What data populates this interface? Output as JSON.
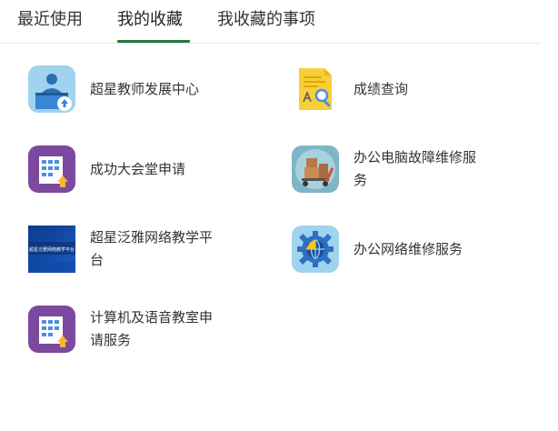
{
  "tabs": [
    {
      "label": "最近使用"
    },
    {
      "label": "我的收藏"
    },
    {
      "label": "我收藏的事项"
    }
  ],
  "active_tab": "我的收藏",
  "apps": [
    {
      "label": "超星教师发展中心",
      "icon": "teacher-podium-icon"
    },
    {
      "label": "成绩查询",
      "icon": "document-search-icon"
    },
    {
      "label": "成功大会堂申请",
      "icon": "building-upload-icon"
    },
    {
      "label": "办公电脑故障维修服务",
      "icon": "repair-cart-icon"
    },
    {
      "label": "超星泛雅网络教学平台",
      "icon": "platform-banner-icon"
    },
    {
      "label": "办公网络维修服务",
      "icon": "gear-globe-icon"
    },
    {
      "label": "计算机及语音教室申请服务",
      "icon": "building-upload-icon"
    }
  ],
  "banner_text": "超星泛雅网络教学平台",
  "colors": {
    "accent": "#1f7a3f",
    "purple": "#7b4aa0",
    "light_blue": "#9fd3ee"
  }
}
